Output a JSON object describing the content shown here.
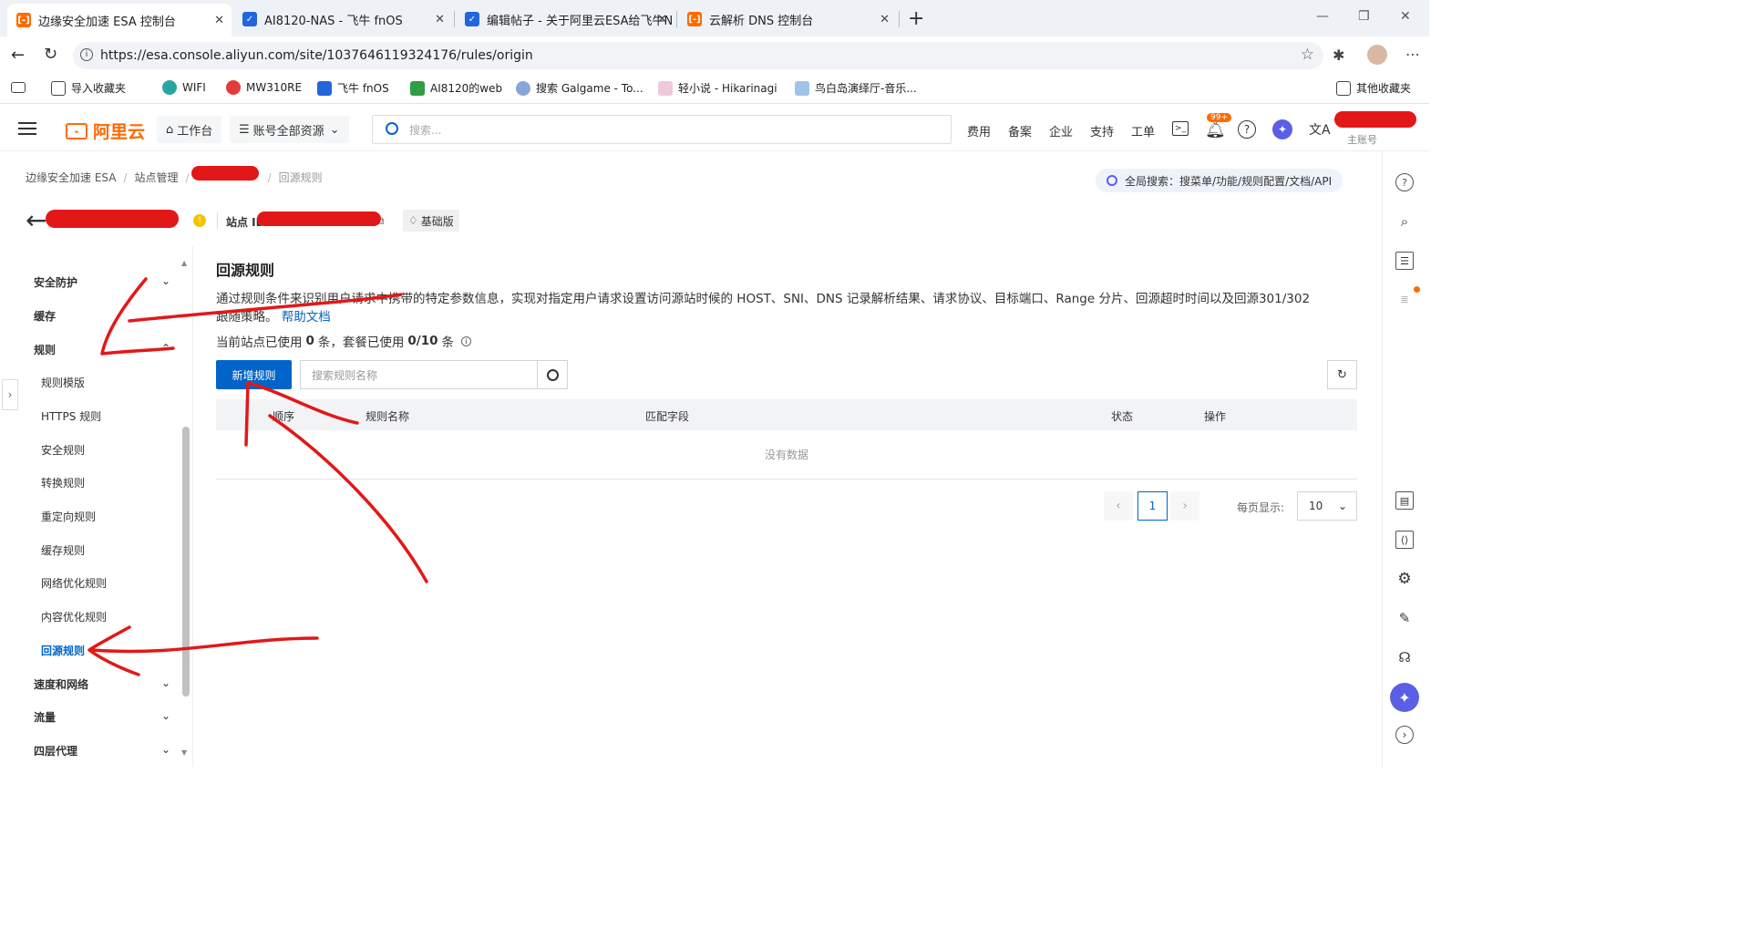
{
  "browser": {
    "tabs": [
      {
        "title": "边缘安全加速 ESA 控制台",
        "active": true,
        "icon": "aliyun-icon"
      },
      {
        "title": "AI8120-NAS - 飞牛 fnOS",
        "active": false,
        "icon": "fnos-icon"
      },
      {
        "title": "编辑帖子 - 关于阿里云ESA给飞牛N",
        "active": false,
        "icon": "fnos-icon"
      },
      {
        "title": "云解析 DNS 控制台",
        "active": false,
        "icon": "aliyun-icon"
      }
    ],
    "new_tab": "+",
    "url": "https://esa.console.aliyun.com/site/1037646119324176/rules/origin",
    "bookmarks": [
      "导入收藏夹",
      "WIFI",
      "MW310RE",
      "飞牛 fnOS",
      "AI8120的web",
      "搜索 Galgame - To...",
      "轻小说 - Hikarinagi",
      "鸟白岛演绎厅-音乐..."
    ],
    "other_bookmarks": "其他收藏夹"
  },
  "header": {
    "logo": "阿里云",
    "workbench": "工作台",
    "resources": "账号全部资源",
    "search_placeholder": "搜索...",
    "nav": [
      "费用",
      "备案",
      "企业",
      "支持",
      "工单"
    ],
    "badge": "99+",
    "account_label": "主账号"
  },
  "breadcrumb": [
    "边缘安全加速 ESA",
    "站点管理",
    "回源规则"
  ],
  "global_search": "全局搜索：搜菜单/功能/规则配置/文档/API",
  "site": {
    "id_label": "站点 ID",
    "plan": "基础版"
  },
  "sidebar": {
    "items": [
      {
        "label": "安全防护",
        "type": "group",
        "expanded": false
      },
      {
        "label": "缓存",
        "type": "group",
        "expanded": false
      },
      {
        "label": "规则",
        "type": "group",
        "expanded": true
      },
      {
        "label": "规则模版",
        "type": "sub"
      },
      {
        "label": "HTTPS 规则",
        "type": "sub"
      },
      {
        "label": "安全规则",
        "type": "sub"
      },
      {
        "label": "转换规则",
        "type": "sub"
      },
      {
        "label": "重定向规则",
        "type": "sub"
      },
      {
        "label": "缓存规则",
        "type": "sub"
      },
      {
        "label": "网络优化规则",
        "type": "sub"
      },
      {
        "label": "内容优化规则",
        "type": "sub"
      },
      {
        "label": "回源规则",
        "type": "sub",
        "selected": true
      },
      {
        "label": "速度和网络",
        "type": "group",
        "expanded": false
      },
      {
        "label": "流量",
        "type": "group",
        "expanded": false
      },
      {
        "label": "四层代理",
        "type": "group",
        "expanded": false
      }
    ]
  },
  "main": {
    "title": "回源规则",
    "description_1": "通过规则条件来识别用户请求中携带的特定参数信息，实现对指定用户请求设置访问源站时候的 HOST、SNI、DNS 记录解析结果、请求协议、目标端口、Range 分片、回源超时时间以及回源301/302",
    "description_2": "跟随策略。",
    "help_link": "帮助文档",
    "usage_prefix": "当前站点已使用",
    "usage_site": "0",
    "usage_mid": "条，套餐已使用",
    "usage_plan": "0/10",
    "usage_suffix": "条",
    "add_button": "新增规则",
    "search_placeholder": "搜索规则名称",
    "table": {
      "columns": [
        "顺序",
        "规则名称",
        "匹配字段",
        "状态",
        "操作"
      ],
      "empty_text": "没有数据"
    },
    "pagination": {
      "current_page": "1",
      "page_size_label": "每页显示:",
      "page_size": "10"
    }
  },
  "colors": {
    "primary": "#0064c8",
    "brand_orange": "#ff6a00",
    "annotation_red": "#e21818"
  }
}
